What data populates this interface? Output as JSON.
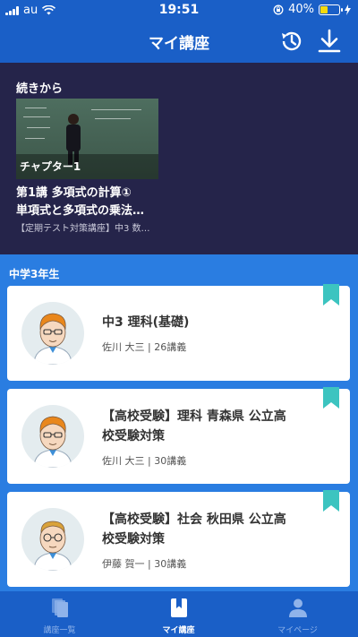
{
  "status_bar": {
    "carrier": "au",
    "time": "19:51",
    "battery_percent": "40%",
    "battery_level": 0.4,
    "battery_color": "#f5d90a"
  },
  "header": {
    "title": "マイ講座",
    "history_icon": "history-clock-icon",
    "download_icon": "download-icon"
  },
  "continue_section": {
    "heading": "続きから",
    "chapter_label": "チャプター1",
    "lesson_title_line1": "第1講 多項式の計算①",
    "lesson_title_line2": "単項式と多項式の乗法…",
    "course": "【定期テスト対策講座】中3 数…"
  },
  "grade_section": {
    "label": "中学3年生"
  },
  "cards": [
    {
      "title_line1": "中3 理科(基礎)",
      "title_line2": "",
      "teacher": "佐川 大三",
      "lectures": "26講義"
    },
    {
      "title_line1": "【高校受験】理科 青森県 公立高",
      "title_line2": "校受験対策",
      "teacher": "佐川 大三",
      "lectures": "30講義"
    },
    {
      "title_line1": "【高校受験】社会 秋田県 公立高",
      "title_line2": "校受験対策",
      "teacher": "伊藤 賀一",
      "lectures": "30講義"
    }
  ],
  "meta_separator": "|",
  "tabs": [
    {
      "label": "講座一覧",
      "icon": "course-list-icon",
      "active": false
    },
    {
      "label": "マイ講座",
      "icon": "bookmark-book-icon",
      "active": true
    },
    {
      "label": "マイページ",
      "icon": "person-icon",
      "active": false
    }
  ],
  "colors": {
    "background": "#2a7de1",
    "header": "#1a5fc7",
    "continue_bg": "#25244a",
    "ribbon": "#3cc4c0"
  }
}
